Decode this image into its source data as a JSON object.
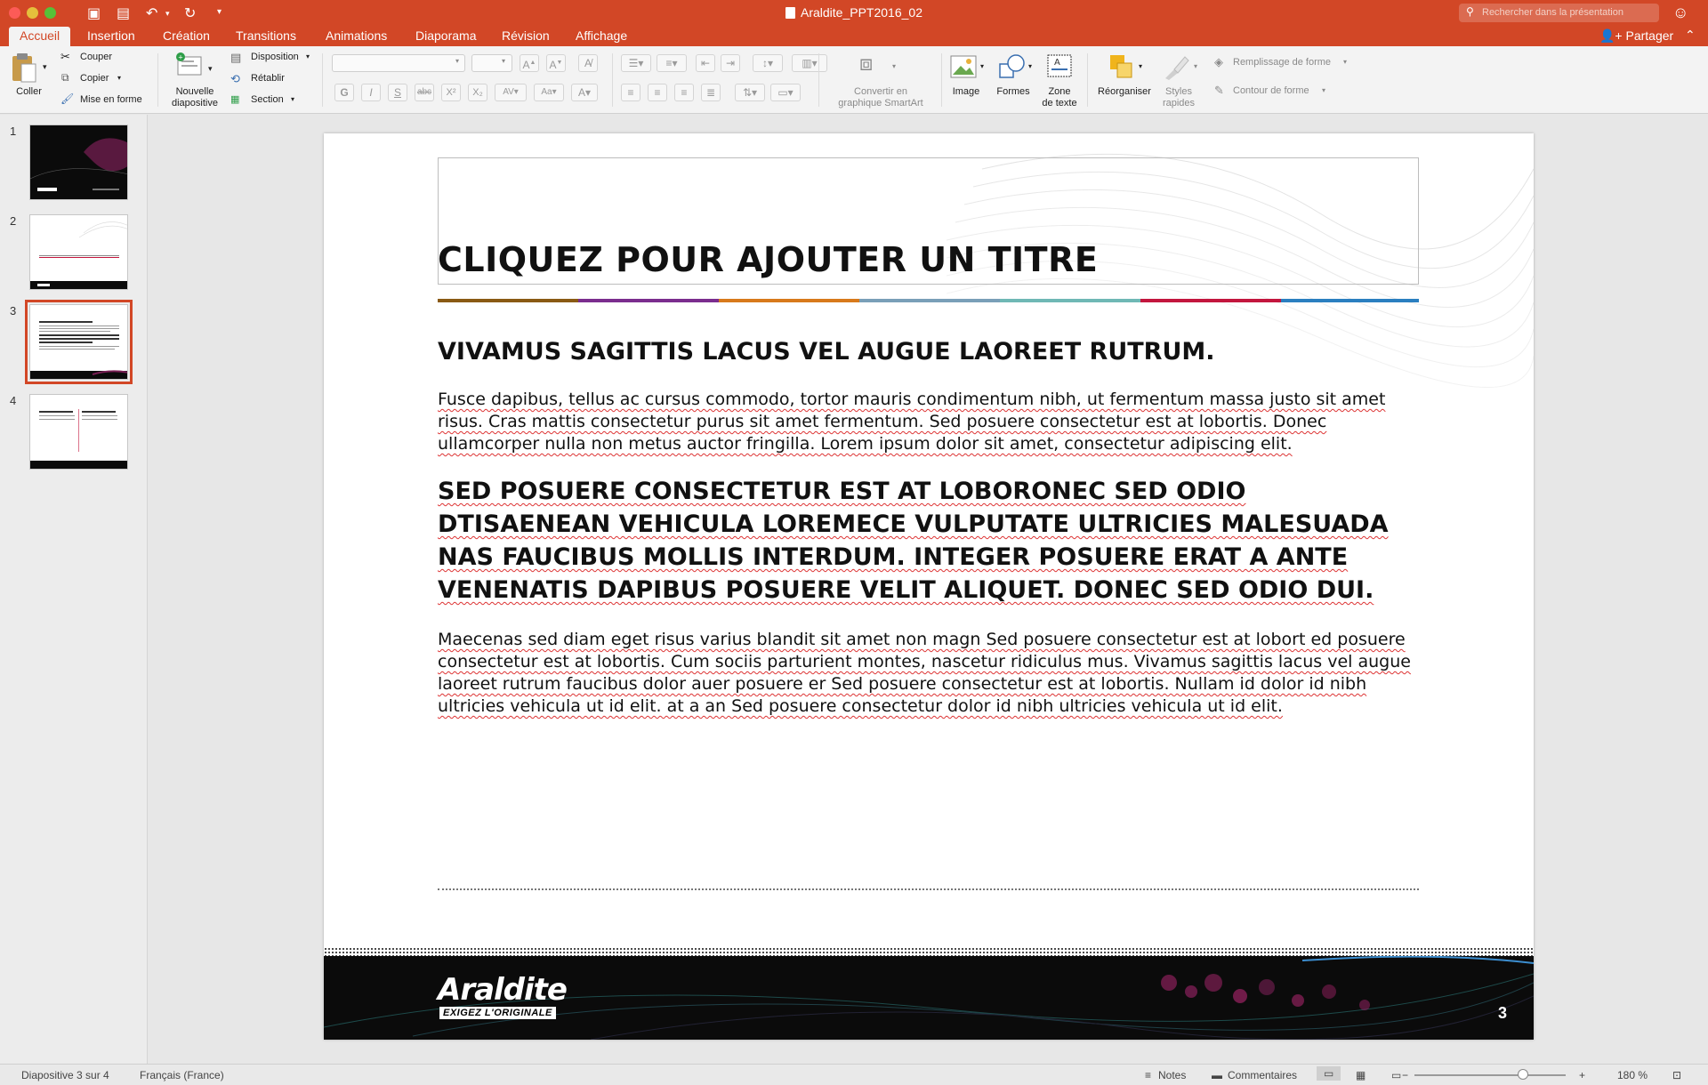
{
  "window": {
    "title": "Araldite_PPT2016_02",
    "search_placeholder": "Rechercher dans la présentation"
  },
  "tabs": [
    {
      "label": "Accueil",
      "active": true
    },
    {
      "label": "Insertion"
    },
    {
      "label": "Création"
    },
    {
      "label": "Transitions"
    },
    {
      "label": "Animations"
    },
    {
      "label": "Diaporama"
    },
    {
      "label": "Révision"
    },
    {
      "label": "Affichage"
    }
  ],
  "share_label": "Partager",
  "ribbon": {
    "paste": "Coller",
    "cut": "Couper",
    "copy": "Copier",
    "format_painter": "Mise en forme",
    "new_slide_line1": "Nouvelle",
    "new_slide_line2": "diapositive",
    "layout": "Disposition",
    "reset": "Rétablir",
    "section": "Section",
    "convert_line1": "Convertir en",
    "convert_line2": "graphique SmartArt",
    "image": "Image",
    "shapes": "Formes",
    "textbox_line1": "Zone",
    "textbox_line2": "de texte",
    "arrange": "Réorganiser",
    "styles_line1": "Styles",
    "styles_line2": "rapides",
    "shape_fill": "Remplissage de forme",
    "shape_outline": "Contour de forme"
  },
  "slides": [
    {
      "number": "1"
    },
    {
      "number": "2"
    },
    {
      "number": "3",
      "selected": true
    },
    {
      "number": "4"
    }
  ],
  "slide": {
    "title": "CLIQUEZ POUR AJOUTER UN TITRE",
    "heading1": "VIVAMUS SAGITTIS LACUS VEL AUGUE LAOREET RUTRUM.",
    "paragraph1": "Fusce dapibus, tellus ac cursus commodo, tortor mauris condimentum nibh, ut fermentum massa justo sit amet risus. Cras mattis consectetur purus sit amet fermentum. Sed posuere consectetur est at lobortis. Donec ullamcorper nulla non metus auctor fringilla. Lorem ipsum dolor sit amet, consectetur adipiscing elit.",
    "heading2": "SED POSUERE CONSECTETUR EST AT LOBORONEC SED ODIO DTISAENEAN VEHICULA LOREMECE VULPUTATE ULTRICIES MALESUADA NAS FAUCIBUS MOLLIS INTERDUM. INTEGER POSUERE ERAT A ANTE VENENATIS DAPIBUS POSUERE VELIT ALIQUET. DONEC SED ODIO DUI.",
    "paragraph2": "Maecenas sed diam eget risus varius blandit sit amet non magn Sed posuere consectetur est at lobort ed posuere consectetur est at lobortis. Cum sociis parturient montes, nascetur ridiculus mus. Vivamus sagittis lacus vel augue laoreet rutrum faucibus dolor auer posuere er Sed posuere consectetur est at lobortis. Nullam id dolor id nibh ultricies vehicula ut id elit. at a an Sed posuere consectetur dolor id nibh ultricies vehicula ut id elit.",
    "logo_text": "Araldite",
    "logo_tagline": "EXIGEZ L'ORIGINALE",
    "page_number": "3",
    "color_bar": [
      "#8a5a14",
      "#7b2d8e",
      "#d87a1c",
      "#7a9fb8",
      "#6fb8b5",
      "#c3163e",
      "#2b7fc0"
    ]
  },
  "status": {
    "slide_position": "Diapositive 3 sur 4",
    "language": "Français (France)",
    "notes": "Notes",
    "comments": "Commentaires",
    "zoom_minus": "−",
    "zoom_plus": "+",
    "zoom_level": "180 %"
  },
  "colors": {
    "accent": "#d24726"
  }
}
